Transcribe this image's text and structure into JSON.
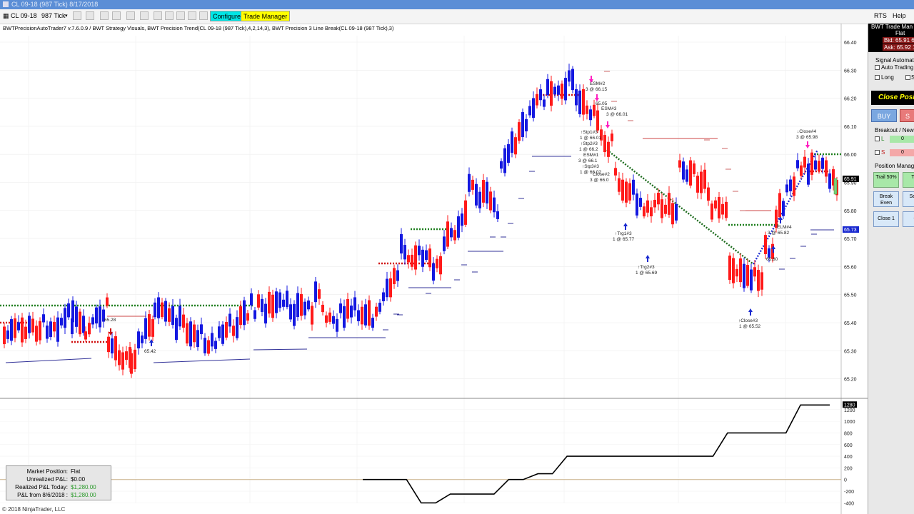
{
  "window": {
    "title": "CL 09-18 (987 Tick)  8/17/2018"
  },
  "toolbar": {
    "instrument": "CL 09-18",
    "interval": "987 Tick",
    "configure_label": "Configure",
    "trade_manager_label": "Trade Manager"
  },
  "menu": {
    "rts": "RTS",
    "help": "Help"
  },
  "indicator_line": "BWTPrecisionAutoTrader7 v.7.6.0.9 / BWT Strategy Visuals, BWT Precision Trend(CL 09-18 (987 Tick),4,2,14,3), BWT Precision 3 Line Break(CL 09-18 (987 Tick),3)",
  "trade_manager": {
    "title": "BWT Trade Man",
    "status": "Flat",
    "bid": "Bid: 65.91 6",
    "ask": "Ask: 65.92 14",
    "signal_automation_label": "Signal Automatio",
    "auto_trading_label": "Auto Trading",
    "long_label": "Long",
    "short_label": "S",
    "close_position_label": "Close Positi",
    "buy_label": "BUY",
    "sell_label": "S",
    "breakout_label": "Breakout / News",
    "l_label": "L",
    "l_value": "0",
    "s_label": "S",
    "s_value": "0",
    "position_manager_label": "Position Manager",
    "trail_label": "Trail 50%",
    "t_label": "T H",
    "break_even_label": "Break Even",
    "set_label": "Set S",
    "close1_label": "Close 1",
    "c_label": "C"
  },
  "pnl_panel": {
    "market_position_label": "Market Position:",
    "market_position_value": "Flat",
    "unrealized_label": "Unrealized P&L:",
    "unrealized_value": "$0.00",
    "realized_label": "Realized P&L Today:",
    "realized_value": "$1,280.00",
    "from_label": "P&L from 8/6/2018 :",
    "from_value": "$1,280.00"
  },
  "copyright": "© 2018 NinjaTrader, LLC",
  "chart_data": [
    {
      "type": "candlestick",
      "y_ticks": [
        "65.40",
        "65.30",
        "65.20",
        "66.10",
        "66.00",
        "65.90",
        "65.80",
        "65.70",
        "65.60",
        "65.50",
        "65.40",
        "65.30",
        "65.20"
      ],
      "ylim": [
        65.15,
        66.42
      ],
      "last_price_label": "65.91",
      "blue_price_label": "65.73",
      "colors": {
        "up": "#1418e0",
        "down": "#ff1a1a",
        "green_dot": "#208020",
        "red_dot": "#d01010"
      },
      "annotations": [
        {
          "text": "65.28"
        },
        {
          "text": "65.42"
        },
        {
          "text": "ESM#2"
        },
        {
          "text": "3 @ 66.15"
        },
        {
          "text": "65.05"
        },
        {
          "text": "ESM#3"
        },
        {
          "text": "3 @ 66.01"
        },
        {
          "text": "↑Stp1#3"
        },
        {
          "text": "1 @ 66.01"
        },
        {
          "text": "↑Stp2#3"
        },
        {
          "text": "1 @ 66.2"
        },
        {
          "text": "ESM#1"
        },
        {
          "text": "3 @ 66.1"
        },
        {
          "text": "↑Stp3#3"
        },
        {
          "text": "1 @ 66.02"
        },
        {
          "text": "Close#2"
        },
        {
          "text": "3 @ 66.0"
        },
        {
          "text": "↑Trg1#3"
        },
        {
          "text": "1 @ 65.77"
        },
        {
          "text": "↑Trg2#3"
        },
        {
          "text": "1 @ 65.69"
        },
        {
          "text": "↓Close#4"
        },
        {
          "text": "3 @ 65.98"
        },
        {
          "text": "ELM#4"
        },
        {
          "text": "3 @ 65.82"
        },
        {
          "text": "65.80"
        },
        {
          "text": "↑Close#3"
        },
        {
          "text": "1 @ 65.52"
        }
      ]
    },
    {
      "type": "line",
      "name": "",
      "y_ticks": [
        "1200",
        "1000",
        "800",
        "600",
        "400",
        "200",
        "0",
        "-200",
        "-400"
      ],
      "ylim": [
        -420,
        1320
      ],
      "last_value_label": "1280",
      "values": [
        0,
        0,
        0,
        0,
        -400,
        -400,
        -250,
        -250,
        -250,
        -250,
        0,
        0,
        100,
        100,
        400,
        400,
        400,
        400,
        400,
        400,
        400,
        400,
        400,
        400,
        400,
        800,
        800,
        800,
        800,
        800,
        1280,
        1280,
        1280
      ]
    }
  ]
}
